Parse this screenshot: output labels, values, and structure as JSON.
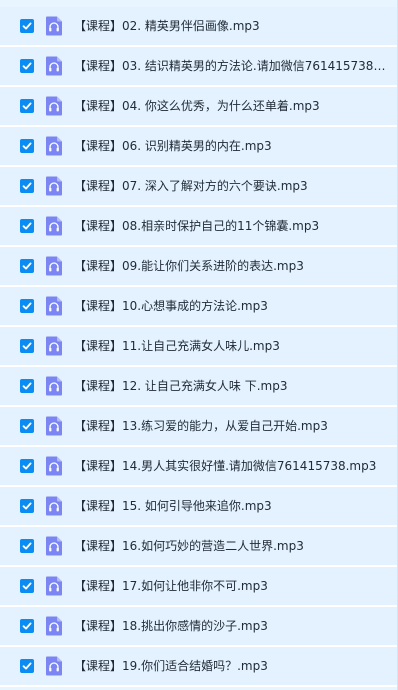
{
  "files": [
    {
      "name": "【课程】02. 精英男伴侣画像.mp3",
      "selected": true
    },
    {
      "name": "【课程】03. 结识精英男的方法论.请加微信761415738....",
      "selected": true
    },
    {
      "name": "【课程】04. 你这么优秀，为什么还单着.mp3",
      "selected": true
    },
    {
      "name": "【课程】06. 识别精英男的内在.mp3",
      "selected": true
    },
    {
      "name": "【课程】07. 深入了解对方的六个要诀.mp3",
      "selected": true
    },
    {
      "name": "【课程】08.相亲时保护自己的11个锦囊.mp3",
      "selected": true
    },
    {
      "name": "【课程】09.能让你们关系进阶的表达.mp3",
      "selected": true
    },
    {
      "name": "【课程】10.心想事成的方法论.mp3",
      "selected": true
    },
    {
      "name": "【课程】11.让自己充满女人味儿.mp3",
      "selected": true
    },
    {
      "name": "【课程】12. 让自己充满女人味 下.mp3",
      "selected": true
    },
    {
      "name": "【课程】13.练习爱的能力，从爱自己开始.mp3",
      "selected": true
    },
    {
      "name": "【课程】14.男人其实很好懂.请加微信761415738.mp3",
      "selected": true
    },
    {
      "name": "【课程】15. 如何引导他来追你.mp3",
      "selected": true
    },
    {
      "name": "【课程】16.如何巧妙的营造二人世界.mp3",
      "selected": true
    },
    {
      "name": "【课程】17.如何让他非你不可.mp3",
      "selected": true
    },
    {
      "name": "【课程】18.挑出你感情的沙子.mp3",
      "selected": true
    },
    {
      "name": "【课程】19.你们适合结婚吗？.mp3",
      "selected": true
    }
  ],
  "colors": {
    "row_background": "#e3f2fe",
    "checkbox": "#0b8cf2",
    "audio_icon": "#7b86f2",
    "text": "#1f2a36"
  },
  "icons": {
    "checkbox": "checkmark-icon",
    "file": "audio-file-icon"
  }
}
